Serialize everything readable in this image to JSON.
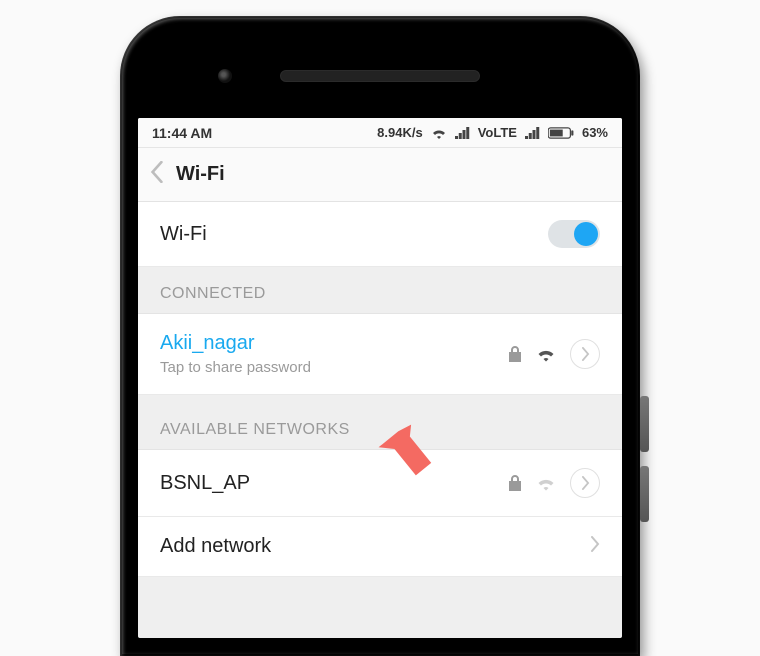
{
  "statusbar": {
    "time": "11:44 AM",
    "speed": "8.94K/s",
    "carrier": "VoLTE",
    "battery": "63%"
  },
  "header": {
    "title": "Wi-Fi"
  },
  "wifi_toggle": {
    "label": "Wi-Fi",
    "on": true
  },
  "sections": {
    "connected_header": "CONNECTED",
    "available_header": "AVAILABLE NETWORKS"
  },
  "connected": {
    "ssid": "Akii_nagar",
    "hint": "Tap to share password",
    "secured": true
  },
  "available": [
    {
      "ssid": "BSNL_AP",
      "secured": true
    }
  ],
  "add_network": {
    "label": "Add network"
  }
}
